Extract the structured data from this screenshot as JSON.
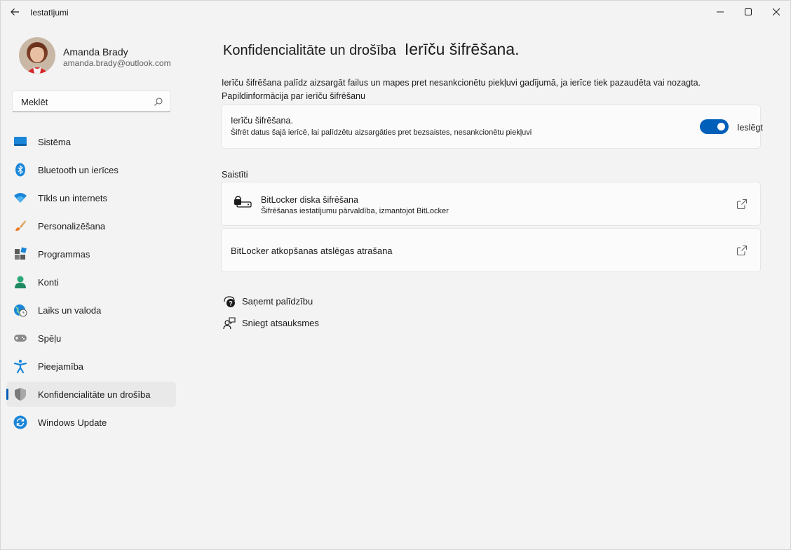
{
  "window": {
    "title": "Iestatījumi"
  },
  "profile": {
    "name": "Amanda Brady",
    "email": "amanda.brady@outlook.com"
  },
  "search": {
    "placeholder": "Meklēt"
  },
  "nav": {
    "items": [
      {
        "label": "Sistēma",
        "icon": "system-icon"
      },
      {
        "label": "Bluetooth un ierīces",
        "icon": "bluetooth-icon"
      },
      {
        "label": "Tīkls un internets",
        "icon": "wifi-icon"
      },
      {
        "label": "Personalizēšana",
        "icon": "brush-icon"
      },
      {
        "label": "Programmas",
        "icon": "apps-icon"
      },
      {
        "label": "Konti",
        "icon": "account-icon"
      },
      {
        "label": "Laiks un valoda",
        "icon": "globe-clock-icon"
      },
      {
        "label": "Spēļu",
        "icon": "gamepad-icon"
      },
      {
        "label": "Pieejamība",
        "icon": "accessibility-icon"
      },
      {
        "label": "Konfidencialitāte un drošība",
        "icon": "shield-icon",
        "active": true
      },
      {
        "label": "Windows Update",
        "icon": "update-icon"
      }
    ]
  },
  "breadcrumb": {
    "parent": "Konfidencialitāte un drošība",
    "current": "Ierīču šifrēšana."
  },
  "description": "Ierīču šifrēšana palīdz aizsargāt failus un mapes pret nesankcionētu piekļuvi gadījumā, ja ierīce tiek pazaudēta vai nozagta. Papildinformācija par ierīču šifrēšanu",
  "encryption": {
    "title": "Ierīču šifrēšana.",
    "subtitle": "Šifrēt datus šajā ierīcē, lai palīdzētu aizsargāties pret bezsaistes, nesankcionētu piekļuvi",
    "toggle_state": "Ieslēgt",
    "toggle_on": true
  },
  "related": {
    "title": "Saistīti",
    "bitlocker": {
      "title": "BitLocker diska šifrēšana",
      "subtitle": "Šifrēšanas iestatījumu pārvaldība, izmantojot BitLocker"
    },
    "recovery": {
      "title": "BitLocker atkopšanas atslēgas atrašana"
    }
  },
  "help": {
    "get_help": "Saņemt palīdzību",
    "feedback": "Sniegt atsauksmes"
  },
  "colors": {
    "accent": "#005fb8",
    "background": "#f3f3f3",
    "card": "#fbfbfb"
  }
}
